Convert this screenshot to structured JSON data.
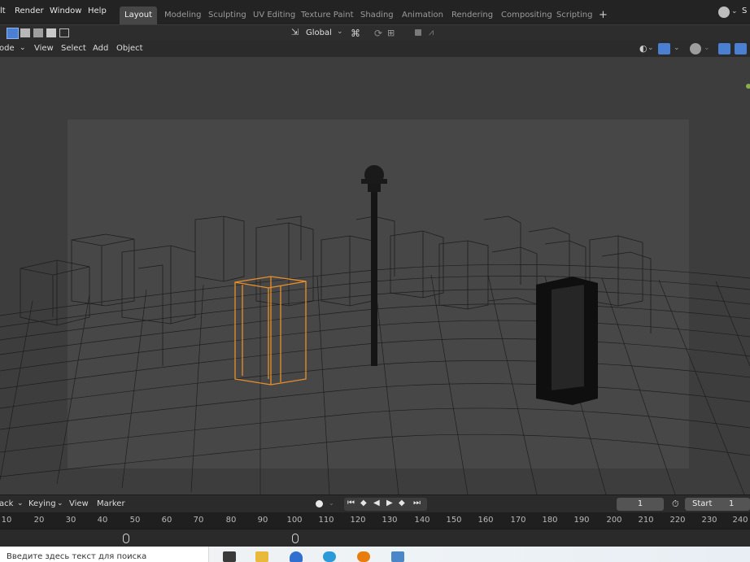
{
  "menubar": {
    "items": [
      "lt",
      "Render",
      "Window",
      "Help"
    ],
    "workspaces": [
      "Layout",
      "Modeling",
      "Sculpting",
      "UV Editing",
      "Texture Paint",
      "Shading",
      "Animation",
      "Rendering",
      "Compositing",
      "Scripting"
    ],
    "active_workspace": "Layout",
    "add_tab": "+",
    "scene_partial": "S"
  },
  "toolbar": {
    "transform_orientation": "Global"
  },
  "viewport_header": {
    "mode": "ode",
    "menus": [
      "View",
      "Select",
      "Add",
      "Object"
    ]
  },
  "timeline": {
    "playback_partial": "ack",
    "keying": "Keying",
    "view": "View",
    "marker": "Marker",
    "current_frame": "1",
    "start_label": "Start",
    "start_value": "1",
    "ruler_ticks": [
      "10",
      "20",
      "30",
      "40",
      "50",
      "60",
      "70",
      "80",
      "90",
      "100",
      "110",
      "120",
      "130",
      "140",
      "150",
      "160",
      "170",
      "180",
      "190",
      "200",
      "210",
      "220",
      "230",
      "240"
    ]
  },
  "taskbar": {
    "search_placeholder": "Введите здесь текст для поиска"
  },
  "colors": {
    "selected_outline": "#e8902a",
    "accent_blue": "#4a7fd1"
  }
}
